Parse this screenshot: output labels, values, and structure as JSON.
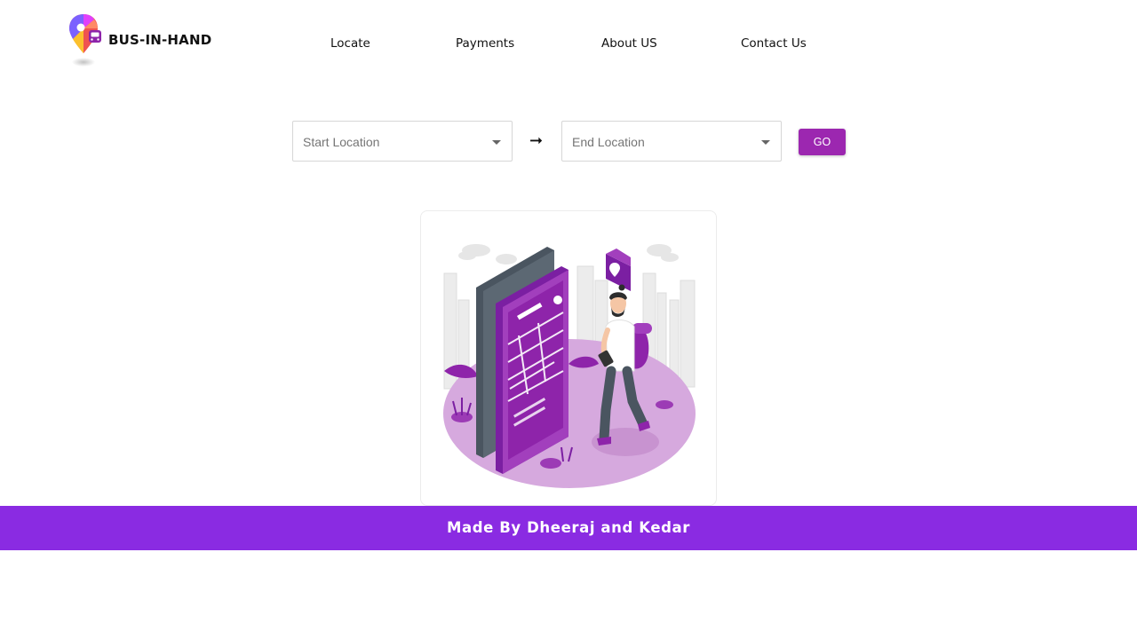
{
  "header": {
    "brand": "BUS-IN-HAND",
    "nav": [
      {
        "label": "Locate"
      },
      {
        "label": "Payments"
      },
      {
        "label": "About US"
      },
      {
        "label": "Contact Us"
      }
    ]
  },
  "search": {
    "start_placeholder": "Start Location",
    "end_placeholder": "End Location",
    "arrow": "➞",
    "go_label": "GO"
  },
  "illustration": {
    "icon": "person-with-map-phone-illustration"
  },
  "footer": {
    "text": "Made By Dheeraj and Kedar"
  },
  "colors": {
    "accent": "#9c27b0",
    "footer_bg": "#8a2be2",
    "illustration_purple": "#a23fbd",
    "illustration_light": "#d6a9de"
  }
}
